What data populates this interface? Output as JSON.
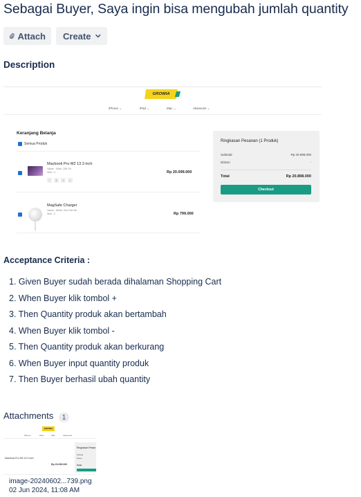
{
  "issue": {
    "title": "Sebagai Buyer, Saya ingin bisa mengubah jumlah quantity"
  },
  "toolbar": {
    "attach_label": "Attach",
    "create_label": "Create"
  },
  "description": {
    "heading": "Description",
    "embed": {
      "logo": "GROWIA",
      "nav": [
        "iPhone ⌄",
        "iPad ⌄",
        "Mac ⌄",
        "Aksesoris ⌄"
      ],
      "cart_title": "Keranjang Belanja",
      "select_all": "Semua Produk",
      "products": [
        {
          "name": "Macbook Pro M2 13.3 inch",
          "meta1": "Varian : Silver, 256 Gb",
          "meta2": "Stok : 4",
          "qty": "1",
          "price": "Rp 20.099.000"
        },
        {
          "name": "MagSafe Charger",
          "meta1": "Varian : White, One Size Bk",
          "meta2": "Stok : 2",
          "qty": "",
          "price": "Rp 799.000"
        }
      ],
      "summary": {
        "title": "Ringkasan Pesanan (1 Produk)",
        "subtotal_label": "Subtotal",
        "subtotal_value": "Rp 20.898.000",
        "discount_label": "Diskon",
        "discount_value": "-",
        "total_label": "Total",
        "total_value": "Rp 20.898.000",
        "checkout_label": "Checkout"
      },
      "stepper": {
        "minus": "−",
        "plus": "+"
      }
    }
  },
  "acceptance": {
    "heading": "Acceptance Criteria :",
    "items": [
      "Given Buyer sudah berada dihalaman Shopping Cart",
      "When Buyer klik tombol +",
      "Then Quantity produk akan bertambah",
      "When Buyer klik tombol -",
      "Then Quantity produk akan berkurang",
      "When Buyer input quantity produk",
      "Then Buyer berhasil ubah quantity"
    ]
  },
  "attachments": {
    "heading": "Attachments",
    "count": "1",
    "files": [
      {
        "name": "image-20240602...739.png",
        "date": "02 Jun 2024, 11:08 AM",
        "thumb": {
          "logo": "GROWIA",
          "nav": [
            "iPhone",
            "iPad",
            "Mac",
            "Aksesoris"
          ],
          "product": "Macbook Pro M2 13.3 inch",
          "price": "Rp 20.099.000",
          "summary_title": "Ringkasan Pesan",
          "subtotal_label": "Subtotal",
          "discount_label": "Diskon",
          "total_label": "Total"
        }
      }
    ]
  },
  "colors": {
    "accent": "#1a9b84",
    "brand_yellow": "#f5d31b",
    "checkbox": "#1f6fd8",
    "text": "#172b4d"
  }
}
